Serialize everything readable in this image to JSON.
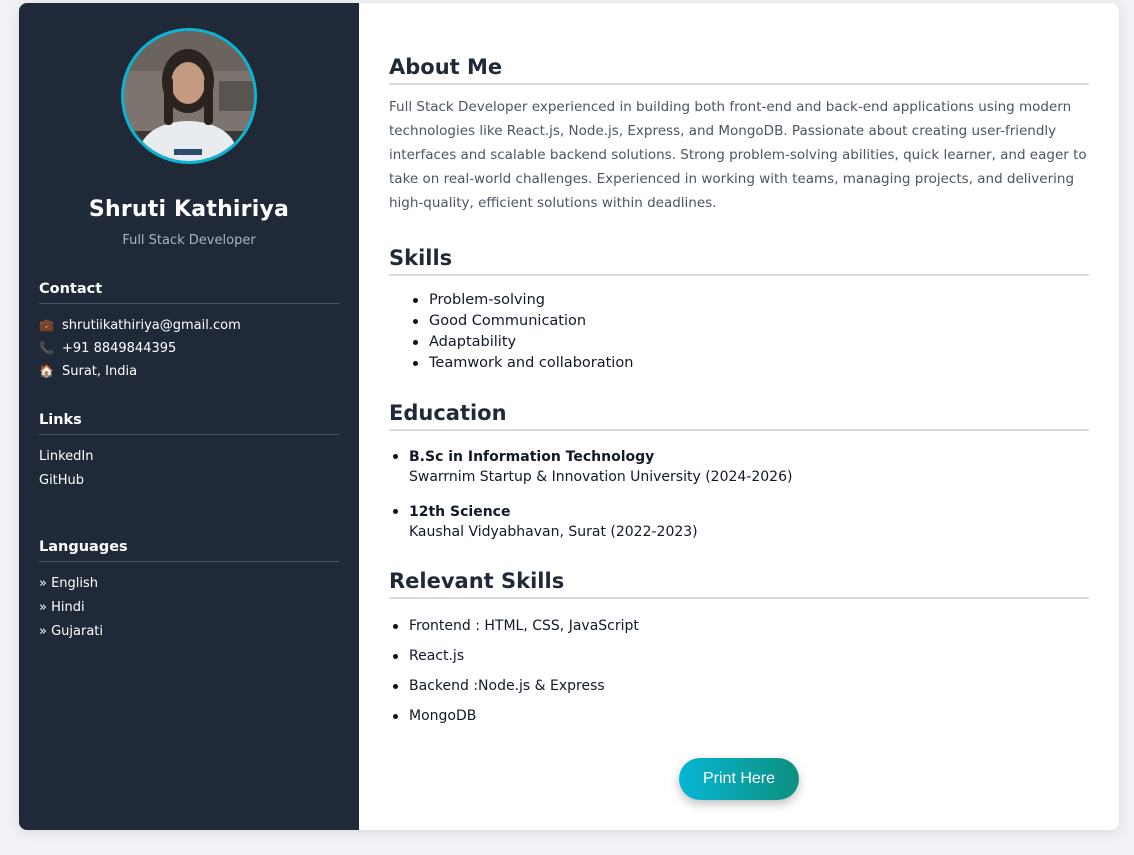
{
  "profile": {
    "name": "Shruti Kathiriya",
    "role": "Full Stack Developer"
  },
  "contact": {
    "heading": "Contact",
    "items": [
      {
        "icon": "briefcase-icon",
        "glyph": "💼",
        "text": "shrutiikathiriya@gmail.com"
      },
      {
        "icon": "phone-icon",
        "glyph": "📞",
        "text": "+91 8849844395"
      },
      {
        "icon": "home-icon",
        "glyph": "🏠",
        "text": "Surat, India"
      }
    ]
  },
  "links": {
    "heading": "Links",
    "items": [
      "LinkedIn",
      "GitHub"
    ]
  },
  "languages": {
    "heading": "Languages",
    "items": [
      "» English",
      "» Hindi",
      "» Gujarati"
    ]
  },
  "about": {
    "title": "About Me",
    "text": "Full Stack Developer experienced in building both front-end and back-end applications using modern technologies like React.js, Node.js, Express, and MongoDB. Passionate about creating user-friendly interfaces and scalable backend solutions. Strong problem-solving abilities, quick learner, and eager to take on real-world challenges. Experienced in working with teams, managing projects, and delivering high-quality, efficient solutions within deadlines."
  },
  "skills": {
    "title": "Skills",
    "items": [
      "Problem-solving",
      "Good Communication",
      "Adaptability",
      "Teamwork and collaboration"
    ]
  },
  "education": {
    "title": "Education",
    "items": [
      {
        "degree": "B.Sc in Information Technology",
        "detail": "Swarrnim Startup & Innovation University (2024-2026)"
      },
      {
        "degree": "12th Science",
        "detail": "Kaushal Vidyabhavan, Surat (2022-2023)"
      }
    ]
  },
  "relevant": {
    "title": "Relevant Skills",
    "items": [
      "Frontend : HTML, CSS, JavaScript",
      "React.js",
      "Backend :Node.js & Express",
      "MongoDB"
    ]
  },
  "print_label": "Print Here",
  "colors": {
    "sidebar": "#1f2937",
    "accent": "#06b6d4",
    "button_end": "#0d8f7e"
  }
}
